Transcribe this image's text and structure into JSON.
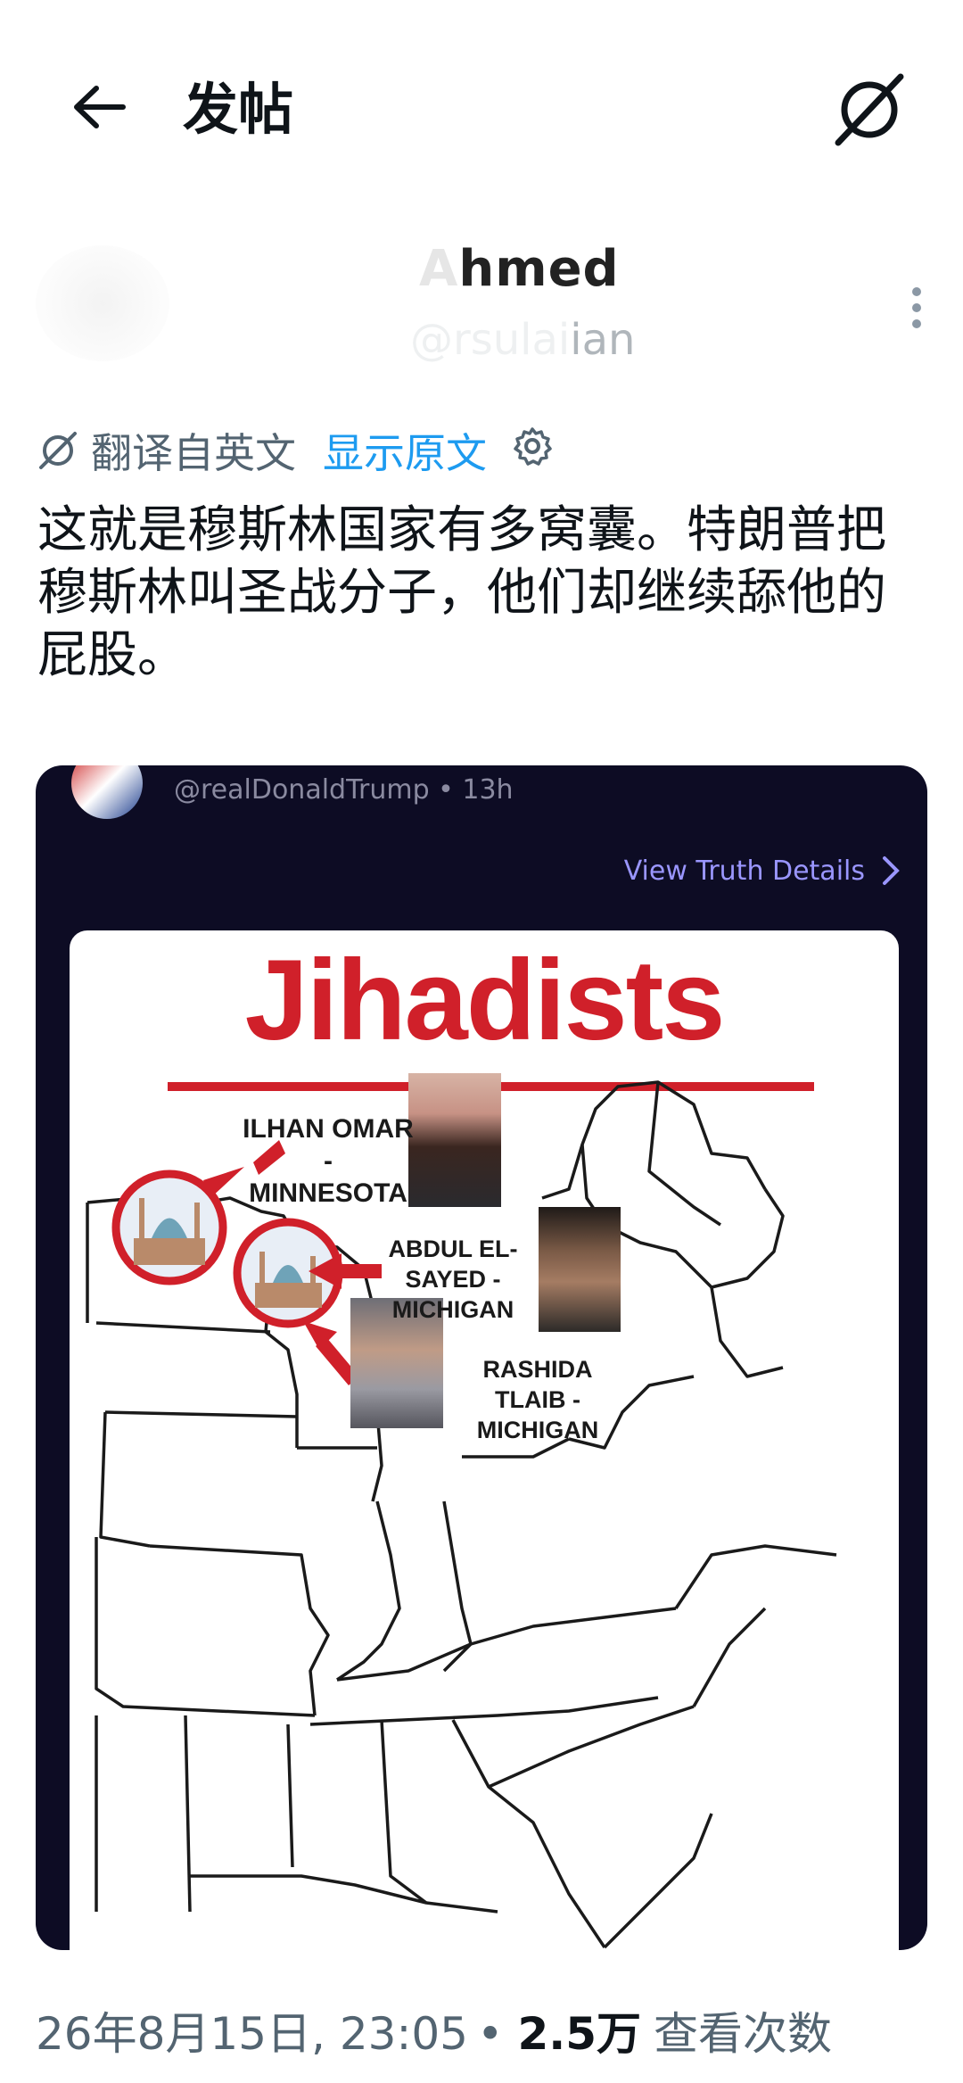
{
  "header": {
    "title": "发帖",
    "back_icon": "arrow-left-icon",
    "grok_icon": "grok-icon"
  },
  "author": {
    "name_visible": "hmed",
    "handle_visible": "ian",
    "more_icon": "more-vertical-icon"
  },
  "translation": {
    "label": "翻译自英文",
    "show_original": "显示原文",
    "translate_icon": "translate-icon",
    "settings_icon": "gear-icon"
  },
  "post": {
    "text": "这就是穆斯林国家有多窝囊。特朗普把穆斯林叫圣战分子，他们却继续舔他的屁股。"
  },
  "media": {
    "truth_user": "@realDonaldTrump • 13h",
    "view_details": "View Truth Details",
    "graphic": {
      "title": "Jihadists",
      "labels": [
        {
          "line1": "ILHAN OMAR -",
          "line2": "MINNESOTA"
        },
        {
          "line1": "ABDUL EL-SAYED -",
          "line2": "MICHIGAN"
        },
        {
          "line1": "RASHIDA TLAIB -",
          "line2": "MICHIGAN"
        }
      ]
    }
  },
  "meta": {
    "date": "26年8月15日, 23:05",
    "separator": "•",
    "views": "2.5万",
    "views_label": "查看次数"
  },
  "colors": {
    "accent": "#1d9bf0",
    "media_bg": "#0d0c24",
    "jihadists_red": "#d0202a"
  }
}
